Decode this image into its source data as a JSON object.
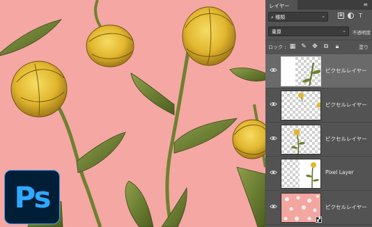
{
  "canvas": {
    "background_color": "#f4a7a3",
    "logo_text": "Ps",
    "logo_colors": {
      "bg": "#001e36",
      "fg": "#31a8ff"
    }
  },
  "panel": {
    "tab_label": "レイヤー",
    "menu_icon": "panel-menu-icon",
    "filter": {
      "value": "種類",
      "icons": [
        "image-filter-icon",
        "adjustment-filter-icon",
        "type-filter-icon"
      ]
    },
    "blend": {
      "mode": "乗算",
      "opacity_label": "不透明度"
    },
    "lock": {
      "label": "ロック :",
      "fill_label": "塗り",
      "icons": [
        "lock-transparency-icon",
        "lock-pixels-icon",
        "lock-position-icon",
        "lock-artboard-icon",
        "lock-all-icon"
      ]
    },
    "layers": [
      {
        "name": "ピクセルレイヤー",
        "selected": true,
        "visible": true
      },
      {
        "name": "ピクセルレイヤー",
        "selected": false,
        "visible": true
      },
      {
        "name": "ピクセルレイヤー",
        "selected": false,
        "visible": true
      },
      {
        "name": "Pixel Layer",
        "selected": false,
        "visible": true
      },
      {
        "name": "ピクセルレイヤー",
        "selected": false,
        "visible": true
      }
    ]
  }
}
